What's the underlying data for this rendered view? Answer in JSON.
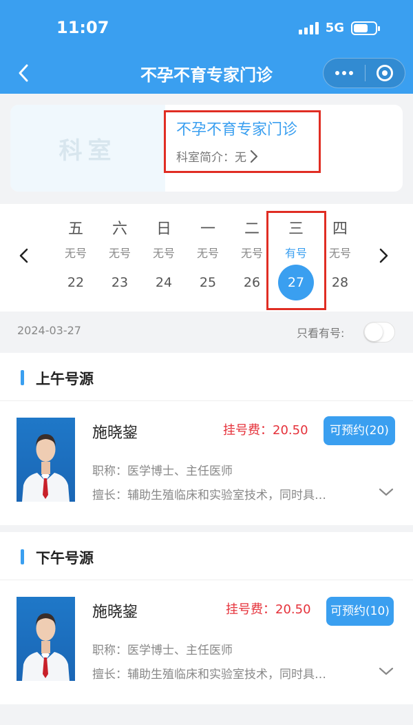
{
  "status": {
    "time": "11:07",
    "network": "5G"
  },
  "nav": {
    "title": "不孕不育专家门诊"
  },
  "department": {
    "image_text": "科室",
    "name": "不孕不育专家门诊",
    "intro_label": "科室简介：",
    "intro_value": "无"
  },
  "calendar": {
    "days": [
      {
        "weekday": "五",
        "availability": "无号",
        "date": "22",
        "selected": false
      },
      {
        "weekday": "六",
        "availability": "无号",
        "date": "23",
        "selected": false
      },
      {
        "weekday": "日",
        "availability": "无号",
        "date": "24",
        "selected": false
      },
      {
        "weekday": "一",
        "availability": "无号",
        "date": "25",
        "selected": false
      },
      {
        "weekday": "二",
        "availability": "无号",
        "date": "26",
        "selected": false
      },
      {
        "weekday": "三",
        "availability": "有号",
        "date": "27",
        "selected": true
      },
      {
        "weekday": "四",
        "availability": "无号",
        "date": "28",
        "selected": false
      }
    ]
  },
  "filter": {
    "date": "2024-03-27",
    "only_available_label": "只看有号:",
    "only_available_on": false
  },
  "sections": [
    {
      "title": "上午号源",
      "doctor": {
        "name": "施晓鋆",
        "fee_label": "挂号费：",
        "fee": "20.50",
        "book_label": "可预约(20)",
        "title_label": "职称：",
        "title": "医学博士、主任医师",
        "skill_label": "擅长：",
        "skill": "辅助生殖临床和实验室技术，同时具…"
      }
    },
    {
      "title": "下午号源",
      "doctor": {
        "name": "施晓鋆",
        "fee_label": "挂号费：",
        "fee": "20.50",
        "book_label": "可预约(10)",
        "title_label": "职称：",
        "title": "医学博士、主任医师",
        "skill_label": "擅长：",
        "skill": "辅助生殖临床和实验室技术，同时具…"
      }
    }
  ],
  "colors": {
    "primary": "#3a9ff0",
    "fee": "#e5313a",
    "highlight_box": "#e02d23"
  }
}
